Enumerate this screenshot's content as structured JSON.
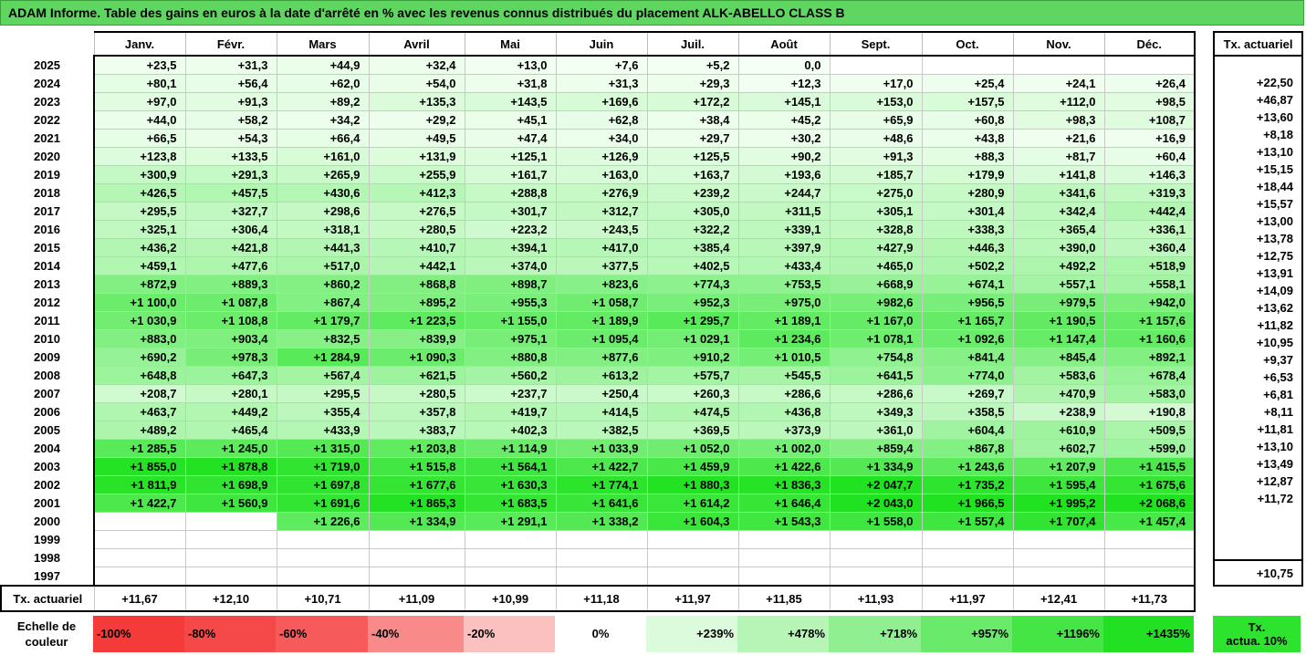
{
  "header": {
    "title": "ADAM Informe. Table des gains en euros à la date d'arrêté en % avec les revenus connus distribués du placement ALK-ABELLO CLASS B"
  },
  "months": [
    "Janv.",
    "Févr.",
    "Mars",
    "Avril",
    "Mai",
    "Juin",
    "Juil.",
    "Août",
    "Sept.",
    "Oct.",
    "Nov.",
    "Déc."
  ],
  "tx_header": "Tx. actuariel",
  "rows": [
    {
      "year": "2025",
      "values": [
        "+23,5",
        "+31,3",
        "+44,9",
        "+32,4",
        "+13,0",
        "+7,6",
        "+5,2",
        "0,0",
        "",
        "",
        "",
        ""
      ],
      "tx": ""
    },
    {
      "year": "2024",
      "values": [
        "+80,1",
        "+56,4",
        "+62,0",
        "+54,0",
        "+31,8",
        "+31,3",
        "+29,3",
        "+12,3",
        "+17,0",
        "+25,4",
        "+24,1",
        "+26,4"
      ],
      "tx": "+22,50"
    },
    {
      "year": "2023",
      "values": [
        "+97,0",
        "+91,3",
        "+89,2",
        "+135,3",
        "+143,5",
        "+169,6",
        "+172,2",
        "+145,1",
        "+153,0",
        "+157,5",
        "+112,0",
        "+98,5"
      ],
      "tx": "+46,87"
    },
    {
      "year": "2022",
      "values": [
        "+44,0",
        "+58,2",
        "+34,2",
        "+29,2",
        "+45,1",
        "+62,8",
        "+38,4",
        "+45,2",
        "+65,9",
        "+60,8",
        "+98,3",
        "+108,7"
      ],
      "tx": "+13,60"
    },
    {
      "year": "2021",
      "values": [
        "+66,5",
        "+54,3",
        "+66,4",
        "+49,5",
        "+47,4",
        "+34,0",
        "+29,7",
        "+30,2",
        "+48,6",
        "+43,8",
        "+21,6",
        "+16,9"
      ],
      "tx": "+8,18"
    },
    {
      "year": "2020",
      "values": [
        "+123,8",
        "+133,5",
        "+161,0",
        "+131,9",
        "+125,1",
        "+126,9",
        "+125,5",
        "+90,2",
        "+91,3",
        "+88,3",
        "+81,7",
        "+60,4"
      ],
      "tx": "+13,10"
    },
    {
      "year": "2019",
      "values": [
        "+300,9",
        "+291,3",
        "+265,9",
        "+255,9",
        "+161,7",
        "+163,0",
        "+163,7",
        "+193,6",
        "+185,7",
        "+179,9",
        "+141,8",
        "+146,3"
      ],
      "tx": "+15,15"
    },
    {
      "year": "2018",
      "values": [
        "+426,5",
        "+457,5",
        "+430,6",
        "+412,3",
        "+288,8",
        "+276,9",
        "+239,2",
        "+244,7",
        "+275,0",
        "+280,9",
        "+341,6",
        "+319,3"
      ],
      "tx": "+18,44"
    },
    {
      "year": "2017",
      "values": [
        "+295,5",
        "+327,7",
        "+298,6",
        "+276,5",
        "+301,7",
        "+312,7",
        "+305,0",
        "+311,5",
        "+305,1",
        "+301,4",
        "+342,4",
        "+442,4"
      ],
      "tx": "+15,57"
    },
    {
      "year": "2016",
      "values": [
        "+325,1",
        "+306,4",
        "+318,1",
        "+280,5",
        "+223,2",
        "+243,5",
        "+322,2",
        "+339,1",
        "+328,8",
        "+338,3",
        "+365,4",
        "+336,1"
      ],
      "tx": "+13,00"
    },
    {
      "year": "2015",
      "values": [
        "+436,2",
        "+421,8",
        "+441,3",
        "+410,7",
        "+394,1",
        "+417,0",
        "+385,4",
        "+397,9",
        "+427,9",
        "+446,3",
        "+390,0",
        "+360,4"
      ],
      "tx": "+13,78"
    },
    {
      "year": "2014",
      "values": [
        "+459,1",
        "+477,6",
        "+517,0",
        "+442,1",
        "+374,0",
        "+377,5",
        "+402,5",
        "+433,4",
        "+465,0",
        "+502,2",
        "+492,2",
        "+518,9"
      ],
      "tx": "+12,75"
    },
    {
      "year": "2013",
      "values": [
        "+872,9",
        "+889,3",
        "+860,2",
        "+868,8",
        "+898,7",
        "+823,6",
        "+774,3",
        "+753,5",
        "+668,9",
        "+674,1",
        "+557,1",
        "+558,1"
      ],
      "tx": "+13,91"
    },
    {
      "year": "2012",
      "values": [
        "+1 100,0",
        "+1 087,8",
        "+867,4",
        "+895,2",
        "+955,3",
        "+1 058,7",
        "+952,3",
        "+975,0",
        "+982,6",
        "+956,5",
        "+979,5",
        "+942,0"
      ],
      "tx": "+14,09"
    },
    {
      "year": "2011",
      "values": [
        "+1 030,9",
        "+1 108,8",
        "+1 179,7",
        "+1 223,5",
        "+1 155,0",
        "+1 189,9",
        "+1 295,7",
        "+1 189,1",
        "+1 167,0",
        "+1 165,7",
        "+1 190,5",
        "+1 157,6"
      ],
      "tx": "+13,62"
    },
    {
      "year": "2010",
      "values": [
        "+883,0",
        "+903,4",
        "+832,5",
        "+839,9",
        "+975,1",
        "+1 095,4",
        "+1 029,1",
        "+1 234,6",
        "+1 078,1",
        "+1 092,6",
        "+1 147,4",
        "+1 160,6"
      ],
      "tx": "+11,82"
    },
    {
      "year": "2009",
      "values": [
        "+690,2",
        "+978,3",
        "+1 284,9",
        "+1 090,3",
        "+880,8",
        "+877,6",
        "+910,2",
        "+1 010,5",
        "+754,8",
        "+841,4",
        "+845,4",
        "+892,1"
      ],
      "tx": "+10,95"
    },
    {
      "year": "2008",
      "values": [
        "+648,8",
        "+647,3",
        "+567,4",
        "+621,5",
        "+560,2",
        "+613,2",
        "+575,7",
        "+545,5",
        "+641,5",
        "+774,0",
        "+583,6",
        "+678,4"
      ],
      "tx": "+9,37"
    },
    {
      "year": "2007",
      "values": [
        "+208,7",
        "+280,1",
        "+295,5",
        "+280,5",
        "+237,7",
        "+250,4",
        "+260,3",
        "+286,6",
        "+286,6",
        "+269,7",
        "+470,9",
        "+583,0"
      ],
      "tx": "+6,53"
    },
    {
      "year": "2006",
      "values": [
        "+463,7",
        "+449,2",
        "+355,4",
        "+357,8",
        "+419,7",
        "+414,5",
        "+474,5",
        "+436,8",
        "+349,3",
        "+358,5",
        "+238,9",
        "+190,8"
      ],
      "tx": "+6,81"
    },
    {
      "year": "2005",
      "values": [
        "+489,2",
        "+465,4",
        "+433,9",
        "+383,7",
        "+402,3",
        "+382,5",
        "+369,5",
        "+373,9",
        "+361,0",
        "+604,4",
        "+610,9",
        "+509,5"
      ],
      "tx": "+8,11"
    },
    {
      "year": "2004",
      "values": [
        "+1 285,5",
        "+1 245,0",
        "+1 315,0",
        "+1 203,8",
        "+1 114,9",
        "+1 033,9",
        "+1 052,0",
        "+1 002,0",
        "+859,4",
        "+867,8",
        "+602,7",
        "+599,0"
      ],
      "tx": "+11,81"
    },
    {
      "year": "2003",
      "values": [
        "+1 855,0",
        "+1 878,8",
        "+1 719,0",
        "+1 515,8",
        "+1 564,1",
        "+1 422,7",
        "+1 459,9",
        "+1 422,6",
        "+1 334,9",
        "+1 243,6",
        "+1 207,9",
        "+1 415,5"
      ],
      "tx": "+13,10"
    },
    {
      "year": "2002",
      "values": [
        "+1 811,9",
        "+1 698,9",
        "+1 697,8",
        "+1 677,6",
        "+1 630,3",
        "+1 774,1",
        "+1 880,3",
        "+1 836,3",
        "+2 047,7",
        "+1 735,2",
        "+1 595,4",
        "+1 675,6"
      ],
      "tx": "+13,49"
    },
    {
      "year": "2001",
      "values": [
        "+1 422,7",
        "+1 560,9",
        "+1 691,6",
        "+1 865,3",
        "+1 683,5",
        "+1 641,6",
        "+1 614,2",
        "+1 646,4",
        "+2 043,0",
        "+1 966,5",
        "+1 995,2",
        "+2 068,6"
      ],
      "tx": "+12,87"
    },
    {
      "year": "2000",
      "values": [
        "",
        "",
        "+1 226,6",
        "+1 334,9",
        "+1 291,1",
        "+1 338,2",
        "+1 604,3",
        "+1 543,3",
        "+1 558,0",
        "+1 557,4",
        "+1 707,4",
        "+1 457,4"
      ],
      "tx": "+11,72"
    },
    {
      "year": "1999",
      "values": [
        "",
        "",
        "",
        "",
        "",
        "",
        "",
        "",
        "",
        "",
        "",
        ""
      ],
      "tx": ""
    },
    {
      "year": "1998",
      "values": [
        "",
        "",
        "",
        "",
        "",
        "",
        "",
        "",
        "",
        "",
        "",
        ""
      ],
      "tx": ""
    },
    {
      "year": "1997",
      "values": [
        "",
        "",
        "",
        "",
        "",
        "",
        "",
        "",
        "",
        "",
        "",
        ""
      ],
      "tx": ""
    }
  ],
  "footer": {
    "label": "Tx. actuariel",
    "values": [
      "+11,67",
      "+12,10",
      "+10,71",
      "+11,09",
      "+10,99",
      "+11,18",
      "+11,97",
      "+11,85",
      "+11,93",
      "+11,97",
      "+12,41",
      "+11,73"
    ],
    "tx": "+10,75"
  },
  "legend": {
    "label_line1": "Echelle de",
    "label_line2": "couleur",
    "items": [
      {
        "text": "-100%",
        "color": "#f53a3a",
        "kind": "neg"
      },
      {
        "text": "-80%",
        "color": "#f54848",
        "kind": "neg"
      },
      {
        "text": "-60%",
        "color": "#f65a5a",
        "kind": "neg"
      },
      {
        "text": "-40%",
        "color": "#f88a8a",
        "kind": "neg"
      },
      {
        "text": "-20%",
        "color": "#fbc0c0",
        "kind": "neg"
      },
      {
        "text": "0%",
        "color": "#ffffff",
        "kind": "zero"
      },
      {
        "text": "+239%",
        "color": "#dcfbdc",
        "kind": "pos"
      },
      {
        "text": "+478%",
        "color": "#b6f5b6",
        "kind": "pos"
      },
      {
        "text": "+718%",
        "color": "#90ef90",
        "kind": "pos"
      },
      {
        "text": "+957%",
        "color": "#6aea6a",
        "kind": "pos"
      },
      {
        "text": "+1196%",
        "color": "#45e545",
        "kind": "pos"
      },
      {
        "text": "+1435%",
        "color": "#22e022",
        "kind": "pos"
      }
    ],
    "tx_line1": "Tx.",
    "tx_line2": "actua. 10%"
  }
}
